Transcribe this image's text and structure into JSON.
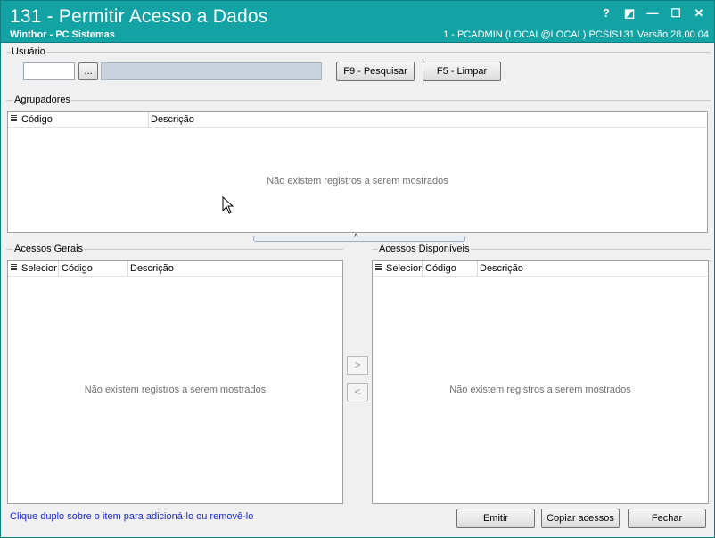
{
  "window": {
    "title": "131 - Permitir Acesso a Dados",
    "subtitle": "Winthor - PC Sistemas",
    "user_info": "1 - PCADMIN (LOCAL@LOCAL)   PCSIS131  Versão 28.00.04",
    "buttons": [
      "?",
      "◩",
      "—",
      "☐",
      "✕"
    ]
  },
  "usuario": {
    "label": "Usuário",
    "code_value": "",
    "name_value": "",
    "lookup_label": "...",
    "search_button": "F9 - Pesquisar",
    "clear_button": "F5 - Limpar"
  },
  "agrupadores": {
    "label": "Agrupadores",
    "columns": [
      "Código",
      "Descrição"
    ],
    "empty_message": "Não existem registros a serem mostrados"
  },
  "acessos_gerais": {
    "label": "Acessos Gerais",
    "columns": [
      "Seleciona",
      "Código",
      "Descrição"
    ],
    "empty_message": "Não existem registros a serem mostrados"
  },
  "acessos_disponiveis": {
    "label": "Acessos Disponíveis",
    "columns": [
      "Selecion",
      "Código",
      "Descrição"
    ],
    "empty_message": "Não existem registros a serem mostrados"
  },
  "transfer": {
    "add_label": ">",
    "remove_label": "<"
  },
  "splitter_glyph": "^",
  "footer": {
    "hint": "Clique duplo sobre o item para adicioná-lo ou removê-lo",
    "emitir": "Emitir",
    "copiar": "Copiar acessos",
    "fechar": "Fechar"
  }
}
